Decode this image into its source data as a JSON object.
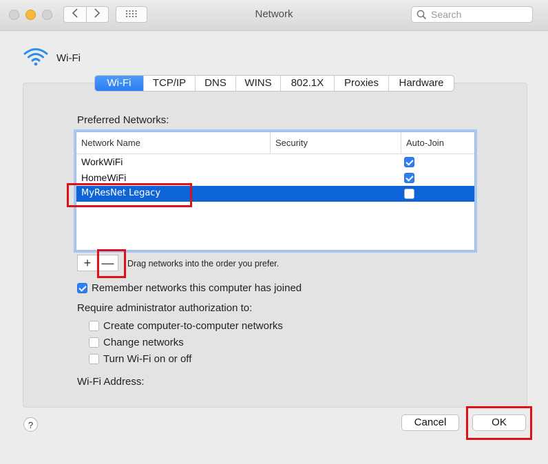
{
  "window": {
    "title": "Network"
  },
  "search": {
    "placeholder": "Search"
  },
  "header": {
    "label": "Wi-Fi"
  },
  "tabs": [
    "Wi-Fi",
    "TCP/IP",
    "DNS",
    "WINS",
    "802.1X",
    "Proxies",
    "Hardware"
  ],
  "active_tab": "Wi-Fi",
  "preferred": {
    "label": "Preferred Networks:",
    "columns": [
      "Network Name",
      "Security",
      "Auto-Join"
    ],
    "rows": [
      {
        "name": "WorkWiFi",
        "security": "",
        "auto_join": true
      },
      {
        "name": "HomeWiFi",
        "security": "",
        "auto_join": true
      },
      {
        "name": "MyResNet Legacy",
        "security": "",
        "auto_join": false
      }
    ],
    "selected_row": "MyResNet Legacy"
  },
  "controls": {
    "plus": "+",
    "minus": "—",
    "hint": "Drag networks into the order you prefer."
  },
  "remember": {
    "label": "Remember networks this computer has joined",
    "checked": true
  },
  "require": {
    "label": "Require administrator authorization to:",
    "options": [
      {
        "label": "Create computer-to-computer networks",
        "checked": false
      },
      {
        "label": "Change networks",
        "checked": false
      },
      {
        "label": "Turn Wi-Fi on or off",
        "checked": false
      }
    ]
  },
  "address": {
    "label": "Wi-Fi Address:"
  },
  "buttons": {
    "help": "?",
    "cancel": "Cancel",
    "ok": "OK"
  },
  "colors": {
    "accent": "#2f7ef4",
    "selection": "#0d64d7",
    "highlight": "#e0101b"
  }
}
